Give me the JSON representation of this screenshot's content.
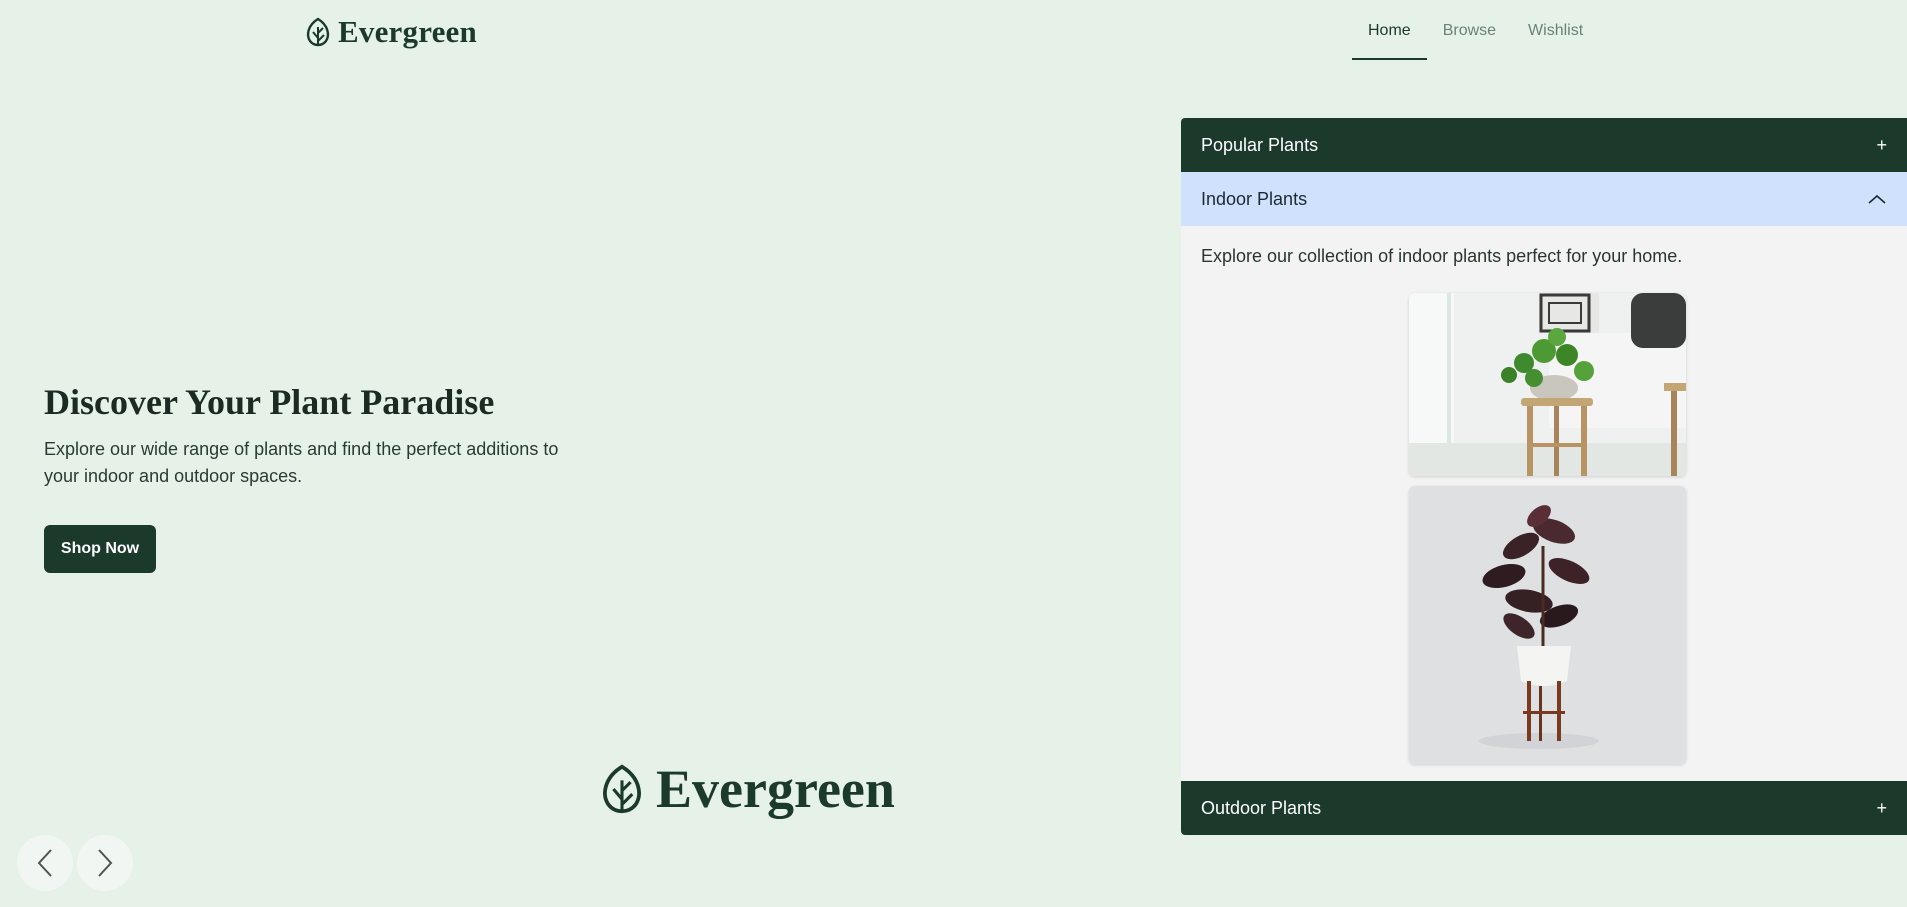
{
  "brand": {
    "name": "Evergreen"
  },
  "nav": {
    "items": [
      {
        "label": "Home",
        "active": true
      },
      {
        "label": "Browse",
        "active": false
      },
      {
        "label": "Wishlist",
        "active": false
      }
    ]
  },
  "hero": {
    "title": "Discover Your Plant Paradise",
    "description": "Explore our wide range of plants and find the perfect additions to your indoor and outdoor spaces.",
    "cta_label": "Shop Now"
  },
  "carousel": {
    "prev_icon": "chevron-left-icon",
    "next_icon": "chevron-right-icon"
  },
  "accordion": {
    "sections": [
      {
        "title": "Popular Plants",
        "symbol": "+",
        "expanded": false
      },
      {
        "title": "Indoor Plants",
        "symbol": "^",
        "expanded": true,
        "body": "Explore our collection of indoor plants perfect for your home."
      },
      {
        "title": "Outdoor Plants",
        "symbol": "+",
        "expanded": false
      }
    ]
  },
  "colors": {
    "background": "#e6f1e8",
    "primary": "#1b3a2c",
    "active_header": "#cfe1fc",
    "panel": "#f3f3f3"
  }
}
